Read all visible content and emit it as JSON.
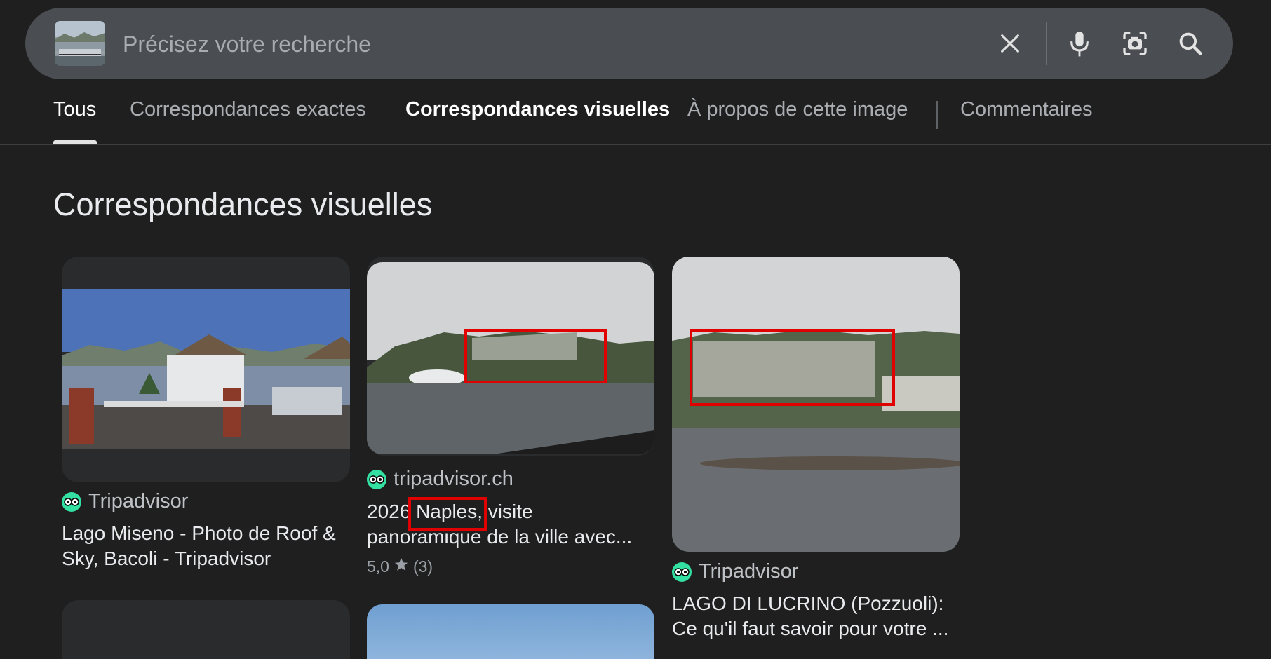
{
  "search": {
    "placeholder": "Précisez votre recherche"
  },
  "tabs": [
    {
      "label": "Tous"
    },
    {
      "label": "Correspondances exactes"
    },
    {
      "label": "Correspondances visuelles"
    },
    {
      "label": "À propos de cette image"
    },
    {
      "label": "Commentaires"
    }
  ],
  "section": {
    "title": "Correspondances visuelles"
  },
  "results": [
    {
      "source": "Tripadvisor",
      "title_line1": "Lago Miseno - Photo de Roof &",
      "title_line2": "Sky, Bacoli - Tripadvisor"
    },
    {
      "source": "tripadvisor.ch",
      "title_line1_a": "2026",
      "title_line1_b": "Naples,",
      "title_line1_c": "visite",
      "title_line2": "panoramique de la ville avec...",
      "rating": "5,0",
      "reviews": "(3)"
    },
    {
      "source": "Tripadvisor",
      "title_line1": "LAGO DI LUCRINO (Pozzuoli):",
      "title_line2": "Ce qu'il faut savoir pour votre ..."
    }
  ],
  "colors": {
    "background": "#1f1f1f",
    "search_bar": "#4a4d51",
    "tripadvisor_green": "#34e0a1",
    "highlight": "#e00000"
  }
}
